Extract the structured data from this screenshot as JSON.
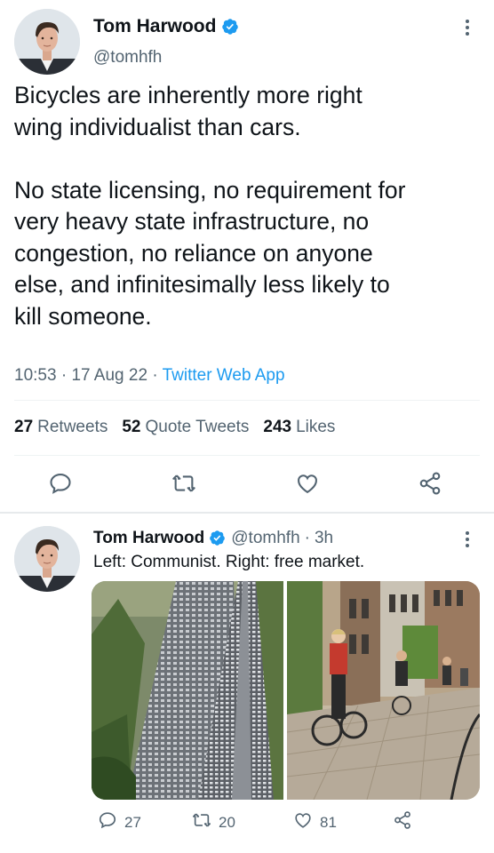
{
  "main_tweet": {
    "author_name": "Tom Harwood",
    "handle": "@tomhfh",
    "text": "Bicycles are inherently more right\nwing individualist than cars.\n\nNo state licensing, no requirement for\nvery heavy state infrastructure, no\ncongestion, no reliance on anyone\nelse, and infinitesimally less likely to\nkill someone.",
    "time": "10:53",
    "date": "17 Aug 22",
    "source": "Twitter Web App",
    "retweets_count": "27",
    "retweets_label": "Retweets",
    "quotes_count": "52",
    "quotes_label": "Quote Tweets",
    "likes_count": "243",
    "likes_label": "Likes"
  },
  "reply_tweet": {
    "author_name": "Tom Harwood",
    "handle": "@tomhfh",
    "time_ago": "3h",
    "text": "Left: Communist. Right: free market.",
    "reply_count": "27",
    "retweet_count": "20",
    "like_count": "81"
  },
  "colors": {
    "accent": "#1d9bf0",
    "secondary_text": "#536471",
    "primary_text": "#0f1419"
  },
  "icons": [
    "verified-badge-icon",
    "more-icon",
    "reply-icon",
    "retweet-icon",
    "like-icon",
    "share-icon"
  ]
}
